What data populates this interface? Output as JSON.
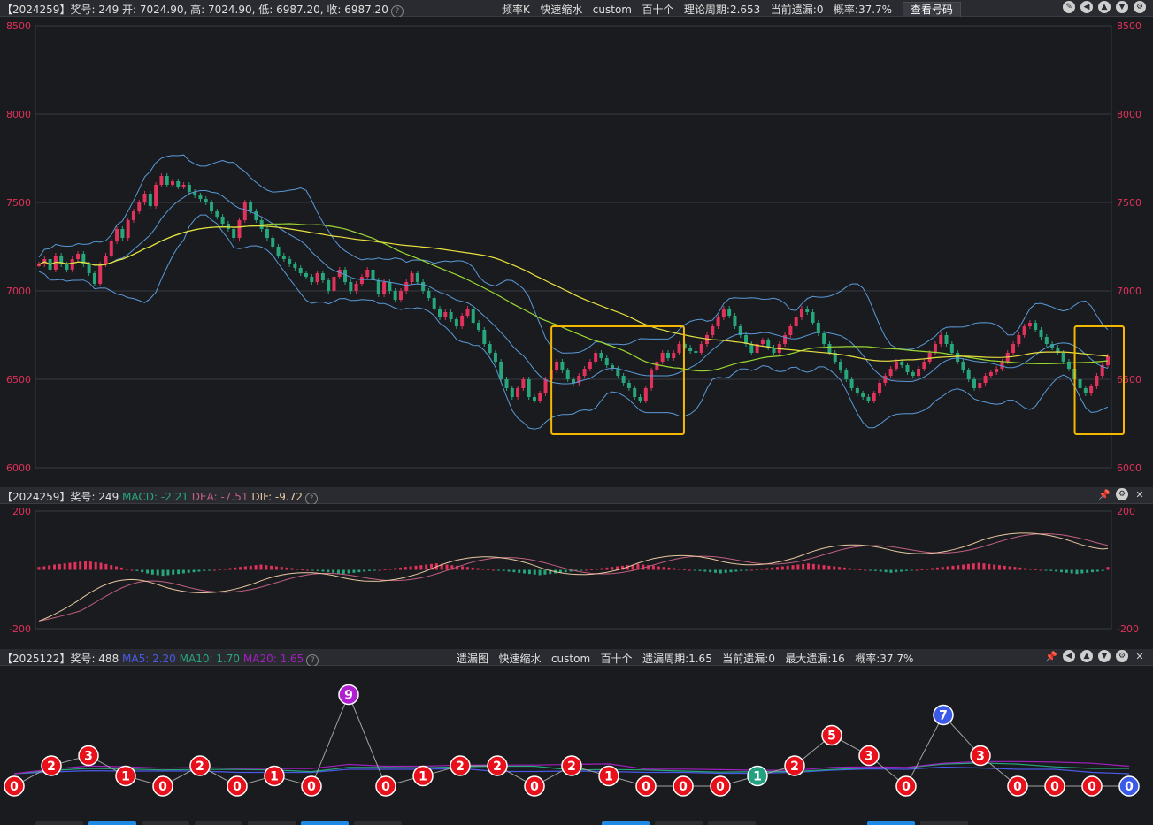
{
  "top_bar": {
    "info": "【2024259】奖号: 249  开: 7024.90, 高: 7024.90, 低: 6987.20, 收: 6987.20",
    "center": [
      "频率K",
      "快速缩水",
      "custom",
      "百十个",
      "理论周期:2.653",
      "当前遗漏:0",
      "概率:37.7%"
    ],
    "button": "查看号码",
    "icons": [
      "edit-icon",
      "back-icon",
      "up-icon",
      "down-icon",
      "settings-icon"
    ]
  },
  "macd_bar": {
    "prefix": "【2024259】奖号: 249",
    "macd": "MACD: -2.21",
    "dea": "DEA: -7.51",
    "dif": "DIF: -9.72",
    "icons": [
      "pin-icon",
      "settings-icon",
      "close-icon"
    ]
  },
  "omit_bar": {
    "prefix": "【2025122】奖号: 488",
    "ma5": "MA5: 2.20",
    "ma10": "MA10: 1.70",
    "ma20": "MA20: 1.65",
    "center": [
      "遗漏图",
      "快速缩水",
      "custom",
      "百十个",
      "遗漏周期:1.65",
      "当前遗漏:0",
      "最大遗漏:16",
      "概率:37.7%"
    ],
    "icons": [
      "pin-icon",
      "back-icon",
      "up-icon",
      "down-icon",
      "settings-icon",
      "close-icon"
    ]
  },
  "colors": {
    "up": "#e0325a",
    "down": "#26a67a",
    "ma_yellow": "#e8e040",
    "ma_green": "#9ad830",
    "boll": "#5a9ad8",
    "highlight": "#f5b800",
    "dif": "#e8c8a0",
    "dea": "#c06080",
    "ma5": "#4a5ae8",
    "ma10": "#26a67a",
    "ma20": "#a020c0"
  },
  "chart_data": [
    {
      "type": "candlestick",
      "yticks": [
        "8500",
        "8000",
        "7500",
        "7000",
        "6500",
        "6000"
      ],
      "ylim": [
        6000,
        8500
      ],
      "close": [
        7150,
        7180,
        7120,
        7200,
        7150,
        7120,
        7180,
        7210,
        7150,
        7100,
        7040,
        7150,
        7200,
        7280,
        7350,
        7300,
        7400,
        7450,
        7500,
        7550,
        7480,
        7600,
        7650,
        7600,
        7620,
        7590,
        7600,
        7560,
        7540,
        7520,
        7500,
        7450,
        7420,
        7380,
        7350,
        7300,
        7400,
        7500,
        7450,
        7400,
        7350,
        7300,
        7250,
        7200,
        7180,
        7150,
        7130,
        7100,
        7080,
        7050,
        7100,
        7060,
        7000,
        7080,
        7120,
        7050,
        7000,
        7040,
        7080,
        7120,
        7060,
        6980,
        7050,
        7000,
        6950,
        7000,
        7050,
        7100,
        7050,
        7000,
        6960,
        6900,
        6850,
        6880,
        6840,
        6800,
        6860,
        6900,
        6820,
        6780,
        6700,
        6650,
        6600,
        6500,
        6450,
        6400,
        6450,
        6500,
        6400,
        6380,
        6420,
        6500,
        6550,
        6600,
        6550,
        6500,
        6480,
        6520,
        6560,
        6600,
        6650,
        6620,
        6580,
        6560,
        6520,
        6480,
        6450,
        6400,
        6380,
        6450,
        6550,
        6600,
        6650,
        6620,
        6650,
        6700,
        6680,
        6660,
        6650,
        6700,
        6750,
        6800,
        6850,
        6900,
        6860,
        6800,
        6750,
        6700,
        6650,
        6700,
        6720,
        6680,
        6650,
        6700,
        6750,
        6800,
        6850,
        6900,
        6880,
        6820,
        6760,
        6700,
        6650,
        6600,
        6550,
        6500,
        6450,
        6420,
        6400,
        6380,
        6420,
        6480,
        6520,
        6560,
        6600,
        6580,
        6540,
        6520,
        6560,
        6600,
        6650,
        6700,
        6750,
        6700,
        6650,
        6600,
        6550,
        6500,
        6450,
        6480,
        6520,
        6540,
        6560,
        6600,
        6650,
        6700,
        6750,
        6800,
        6820,
        6780,
        6740,
        6700,
        6680,
        6650,
        6600,
        6560,
        6500,
        6450,
        6420,
        6460,
        6520,
        6580,
        6630
      ]
    },
    {
      "type": "macd",
      "yticks": [
        "200",
        "-200"
      ],
      "ylim": [
        -200,
        200
      ],
      "hist": [
        10,
        12,
        15,
        18,
        20,
        22,
        24,
        26,
        28,
        30,
        28,
        26,
        24,
        20,
        16,
        12,
        8,
        4,
        0,
        -4,
        -8,
        -12,
        -16,
        -18,
        -20,
        -18,
        -16,
        -14,
        -12,
        -10,
        -8,
        -6,
        -4,
        -2,
        0,
        2,
        4,
        6,
        8,
        10,
        12,
        14,
        16,
        18,
        16,
        14,
        12,
        10,
        8,
        6,
        4,
        2,
        0,
        -2,
        -4,
        -6,
        -8,
        -10,
        -12,
        -14,
        -12,
        -10,
        -8,
        -6,
        -4,
        -2,
        0,
        2,
        4,
        6,
        8,
        10,
        12,
        14,
        16,
        18,
        20,
        22,
        20,
        18,
        16,
        14,
        12,
        10,
        8,
        6,
        4,
        2,
        0,
        -2,
        -4,
        -6,
        -8,
        -10,
        -12,
        -14,
        -16,
        -18,
        -16,
        -14,
        -12,
        -10,
        -8,
        -6,
        -4,
        -2,
        0,
        2,
        4,
        6,
        8,
        10,
        12,
        14,
        16,
        18,
        20,
        18,
        16,
        14,
        12,
        10,
        8,
        6,
        4,
        2,
        0,
        -2,
        -4,
        -6,
        -8,
        -10,
        -12,
        -10,
        -8,
        -6,
        -4,
        -2,
        0,
        2,
        4,
        6,
        8,
        10,
        12,
        14,
        16,
        18,
        20,
        22,
        20,
        18,
        16,
        14,
        12,
        10,
        8,
        6,
        4,
        2,
        0,
        -2,
        -4,
        -6,
        -8,
        -10,
        -8,
        -6,
        -4,
        -2,
        0,
        2,
        4,
        6,
        8,
        10,
        12,
        14,
        16,
        18,
        20,
        22,
        24,
        22,
        20,
        18,
        16,
        14,
        12,
        10,
        8,
        6,
        4,
        2,
        0,
        -2,
        -4,
        -6,
        -8,
        -10,
        -12,
        -14,
        -12,
        -10,
        -8,
        -6,
        -4,
        10
      ]
    },
    {
      "type": "omission-scatter",
      "x": [
        0,
        1,
        2,
        3,
        4,
        5,
        6,
        7,
        8,
        9,
        10,
        11,
        12,
        13,
        14,
        15,
        16,
        17,
        18,
        19,
        20,
        21,
        22,
        23,
        24,
        25,
        26,
        27,
        28,
        29,
        30
      ],
      "values": [
        0,
        2,
        3,
        1,
        0,
        2,
        0,
        1,
        0,
        9,
        0,
        1,
        2,
        2,
        0,
        2,
        1,
        0,
        0,
        0,
        1,
        2,
        5,
        3,
        0,
        7,
        3,
        0,
        0,
        0,
        0
      ],
      "highlight": {
        "9": "#b020d0",
        "20": "#22a080",
        "25": "#3c5ae8",
        "30": "#3c5ae8"
      }
    }
  ]
}
